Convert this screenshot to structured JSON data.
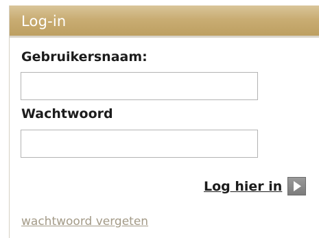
{
  "panel": {
    "title": "Log-in"
  },
  "form": {
    "username_label": "Gebruikersnaam:",
    "username_value": "",
    "password_label": "Wachtwoord",
    "password_value": "",
    "submit_label": "Log hier in",
    "submit_icon": "play-arrow-icon",
    "forgot_label": "wachtwoord vergeten"
  },
  "colors": {
    "header_gold": "#c9ad73",
    "link_muted": "#a39a87",
    "button_gray": "#7c7c7c"
  }
}
